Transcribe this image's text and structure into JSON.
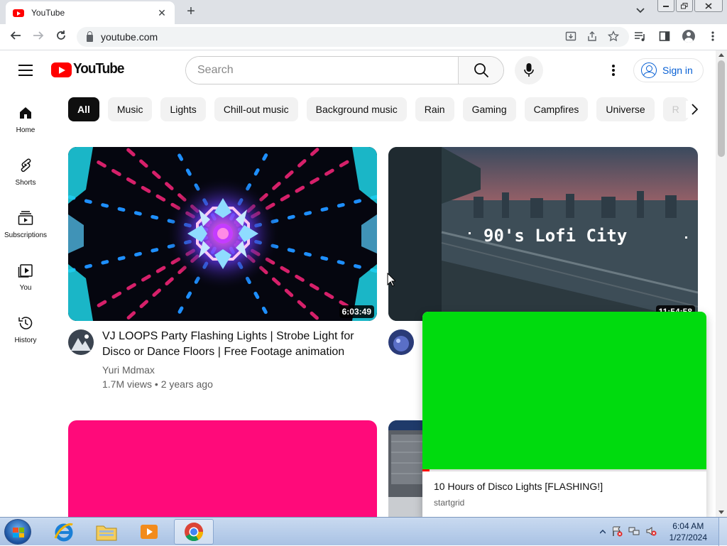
{
  "browser": {
    "tab_title": "YouTube",
    "tab_close": "✕",
    "new_tab": "+",
    "url": "youtube.com"
  },
  "masthead": {
    "logo_text": "YouTube",
    "search_placeholder": "Search",
    "signin_label": "Sign in"
  },
  "guide": {
    "items": [
      {
        "label": "Home",
        "icon": "home-icon"
      },
      {
        "label": "Shorts",
        "icon": "shorts-icon"
      },
      {
        "label": "Subscriptions",
        "icon": "subscriptions-icon"
      },
      {
        "label": "You",
        "icon": "you-icon"
      },
      {
        "label": "History",
        "icon": "history-icon"
      }
    ]
  },
  "chips": [
    "All",
    "Music",
    "Lights",
    "Chill-out music",
    "Background music",
    "Rain",
    "Gaming",
    "Campfires",
    "Universe",
    "R"
  ],
  "videos": [
    {
      "title_line1": "VJ LOOPS Party Flashing Lights | Strobe Light for",
      "title_line2": "Disco or Dance Floors | Free Footage animation",
      "channel": "Yuri Mdmax",
      "meta": "1.7M views • 2 years ago",
      "duration": "6:03:49"
    },
    {
      "overlay_text": "90's Lofi City",
      "duration": "11:54:58"
    }
  ],
  "miniplayer": {
    "title": "10 Hours of Disco Lights [FLASHING!]",
    "channel": "startgrid",
    "progress_fraction": 0.025
  },
  "taskbar": {
    "time": "6:04 AM",
    "date": "1/27/2024"
  },
  "colors": {
    "yt_red": "#ff0000",
    "link_blue": "#065fd4",
    "mini_green": "#00db0e",
    "pink_thumb": "#ff0a7a"
  }
}
